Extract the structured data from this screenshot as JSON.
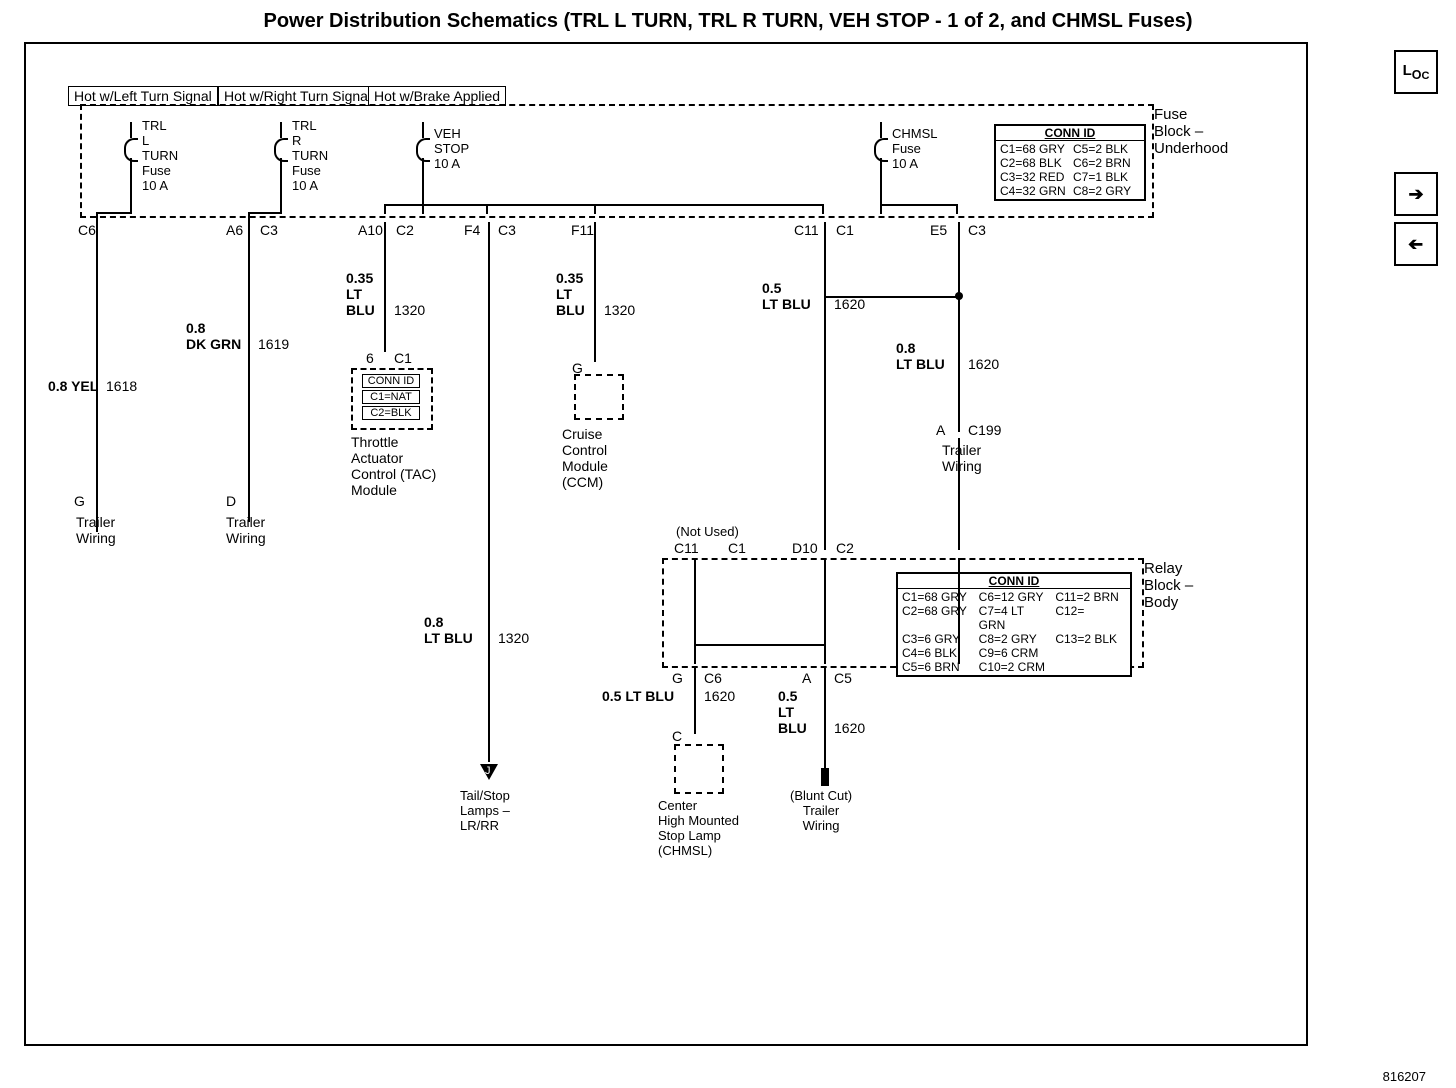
{
  "title": "Power Distribution Schematics (TRL L TURN, TRL R TURN, VEH STOP - 1 of 2, and CHMSL Fuses)",
  "doc_id": "816207",
  "hot_labels": {
    "left": "Hot w/Left Turn Signal",
    "right": "Hot w/Right Turn Signal",
    "brake": "Hot w/Brake Applied"
  },
  "fuse_block_uh": {
    "name": "Fuse\nBlock –\nUnderhood",
    "fuses": [
      {
        "id": "trl_l",
        "lines": [
          "TRL",
          "L",
          "TURN",
          "Fuse",
          "10 A"
        ]
      },
      {
        "id": "trl_r",
        "lines": [
          "TRL",
          "R",
          "TURN",
          "Fuse",
          "10 A"
        ]
      },
      {
        "id": "veh_stop",
        "lines": [
          "VEH",
          "STOP",
          "10 A"
        ]
      },
      {
        "id": "chmsl",
        "lines": [
          "CHMSL",
          "Fuse",
          "10 A"
        ]
      }
    ],
    "connid_header": "CONN ID",
    "connid": [
      "C1=68 GRY",
      "C5=2 BLK",
      "C2=68 BLK",
      "C6=2 BRN",
      "C3=32 RED",
      "C7=1 BLK",
      "C4=32 GRN",
      "C8=2 GRY"
    ]
  },
  "pins_top": {
    "c6": "C6",
    "a6": "A6",
    "c3a": "C3",
    "a10": "A10",
    "c2": "C2",
    "f4": "F4",
    "c3b": "C3",
    "f11": "F11",
    "c11": "C11",
    "c1": "C1",
    "e5": "E5",
    "c3c": "C3"
  },
  "wires": {
    "yel": {
      "gauge": "0.8 YEL",
      "circuit": "1618"
    },
    "dkgrn": {
      "gauge": "0.8\nDK GRN",
      "circuit": "1619"
    },
    "ltblu35a": {
      "gauge": "0.35\nLT\nBLU",
      "circuit": "1320"
    },
    "ltblu35b": {
      "gauge": "0.35\nLT\nBLU",
      "circuit": "1320"
    },
    "ltblu5": {
      "gauge": "0.5\nLT BLU",
      "circuit": "1620"
    },
    "ltblu8": {
      "gauge": "0.8\nLT BLU",
      "circuit": "1620"
    },
    "ltblu8b": {
      "gauge": "0.8\nLT BLU",
      "circuit": "1320"
    },
    "ltblu5b": {
      "gauge": "0.5 LT BLU",
      "circuit": "1620"
    },
    "ltblu5c": {
      "gauge": "0.5\nLT\nBLU",
      "circuit": "1620"
    }
  },
  "components": {
    "trailer_wiring_l": "Trailer\nWiring",
    "trailer_wiring_r": "Trailer\nWiring",
    "tac": {
      "label": "Throttle\nActuator\nControl (TAC)\nModule",
      "pin": "6",
      "conn": "C1",
      "connid_header": "CONN ID",
      "connid": [
        "C1=NAT",
        "C2=BLK"
      ]
    },
    "ccm": {
      "label": "Cruise\nControl\nModule\n(CCM)",
      "pin": "G"
    },
    "c199": {
      "pin": "A",
      "conn": "C199",
      "label": "Trailer\nWiring"
    },
    "taillamps": "Tail/Stop\nLamps –\nLR/RR",
    "chmsl_lamp": {
      "pin": "C",
      "label": "Center\nHigh Mounted\nStop Lamp\n(CHMSL)"
    },
    "blunt": {
      "label": "(Blunt Cut)\nTrailer\nWiring"
    }
  },
  "pins_trailer": {
    "g": "G",
    "d": "D"
  },
  "relay_block": {
    "name": "Relay\nBlock –\nBody",
    "not_used": "(Not Used)",
    "top_pins": {
      "c11": "C11",
      "c1": "C1",
      "d10": "D10",
      "c2": "C2"
    },
    "connid_header": "CONN ID",
    "connid": [
      "C1=68 GRY",
      "C6=12 GRY",
      "C11=2 BRN",
      "C2=68 GRY",
      "C7=4 LT GRN",
      "C12=",
      "C3=6 GRY",
      "C8=2 GRY",
      "C13=2 BLK",
      "C4=6 BLK",
      "C9=6 CRM",
      "",
      "C5=6 BRN",
      "C10=2 CRM",
      ""
    ],
    "bot_pins": {
      "g": "G",
      "c6": "C6",
      "a": "A",
      "c5": "C5"
    }
  },
  "nav": {
    "loc": "LOC",
    "next": "→",
    "prev": "←"
  }
}
